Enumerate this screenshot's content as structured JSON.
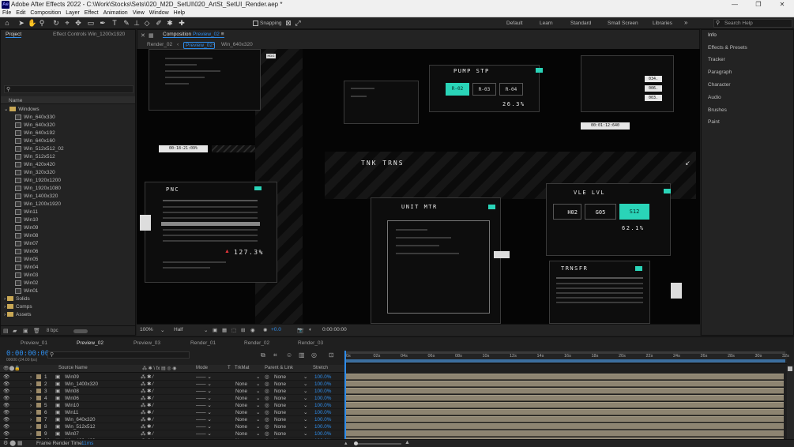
{
  "window": {
    "title": "Adobe After Effects 2022 - C:\\Work\\Stocks\\Sets\\020_M2D_SetUI\\020_ArtSt_SetUI_Render.aep *",
    "app_badge": "Ae"
  },
  "menu": [
    "File",
    "Edit",
    "Composition",
    "Layer",
    "Effect",
    "Animation",
    "View",
    "Window",
    "Help"
  ],
  "toolbar": {
    "snapping": "Snapping",
    "workspaces": [
      "Default",
      "Learn",
      "Standard",
      "Small Screen",
      "Libraries"
    ],
    "search_placeholder": "Search Help"
  },
  "project": {
    "tabs": [
      "Project",
      "Effect Controls Win_1200x1920"
    ],
    "column": "Name",
    "bpc": "8 bpc",
    "items": [
      {
        "name": "Windows",
        "type": "folder",
        "level": 0
      },
      {
        "name": "Win_640x330",
        "type": "comp",
        "level": 1
      },
      {
        "name": "Win_640x320",
        "type": "comp",
        "level": 1
      },
      {
        "name": "Win_640x192",
        "type": "comp",
        "level": 1
      },
      {
        "name": "Win_640x160",
        "type": "comp",
        "level": 1
      },
      {
        "name": "Win_512x512_02",
        "type": "comp",
        "level": 1
      },
      {
        "name": "Win_512x512",
        "type": "comp",
        "level": 1
      },
      {
        "name": "Win_420x420",
        "type": "comp",
        "level": 1
      },
      {
        "name": "Win_320x320",
        "type": "comp",
        "level": 1
      },
      {
        "name": "Win_1920x1200",
        "type": "comp",
        "level": 1
      },
      {
        "name": "Win_1920x1080",
        "type": "comp",
        "level": 1
      },
      {
        "name": "Win_1400x320",
        "type": "comp",
        "level": 1
      },
      {
        "name": "Win_1200x1920",
        "type": "comp",
        "level": 1
      },
      {
        "name": "Win11",
        "type": "comp",
        "level": 1
      },
      {
        "name": "Win10",
        "type": "comp",
        "level": 1
      },
      {
        "name": "Win09",
        "type": "comp",
        "level": 1
      },
      {
        "name": "Win08",
        "type": "comp",
        "level": 1
      },
      {
        "name": "Win07",
        "type": "comp",
        "level": 1
      },
      {
        "name": "Win06",
        "type": "comp",
        "level": 1
      },
      {
        "name": "Win05",
        "type": "comp",
        "level": 1
      },
      {
        "name": "Win04",
        "type": "comp",
        "level": 1
      },
      {
        "name": "Win03",
        "type": "comp",
        "level": 1
      },
      {
        "name": "Win02",
        "type": "comp",
        "level": 1
      },
      {
        "name": "Win01",
        "type": "comp",
        "level": 1
      },
      {
        "name": "Solids",
        "type": "folder",
        "level": 0
      },
      {
        "name": "Comps",
        "type": "folder",
        "level": 0
      },
      {
        "name": "Assets",
        "type": "folder",
        "level": 0
      }
    ]
  },
  "composition": {
    "panel_label": "Composition",
    "panel_name": "Preview_02",
    "breadcrumbs": [
      "Render_02",
      "Preview_02",
      "Win_640x320"
    ],
    "zoom": "100%",
    "resolution": "Half",
    "exposure": "+0.0",
    "timecode": "0:00:00:00",
    "hud": {
      "pump": "PUMP STP",
      "r02": "R-02",
      "r03": "R-03",
      "r04": "R-04",
      "pump_pct": "26.3%",
      "tnk": "TNK TRNS",
      "unit": "UNIT MTR",
      "vle": "VLE LVL",
      "h02": "H02",
      "g05": "G05",
      "s12": "S12",
      "vle_pct": "62.1%",
      "pnc": "PNC",
      "pnc_pct": "127.3%",
      "transfr": "TRNSFR",
      "time1": "00:18:21:09%",
      "time2": "00:01:12:640",
      "hdg": "HDG",
      "v1": "034.",
      "v2": "006.",
      "v3": "003."
    }
  },
  "right_panels": [
    "Info",
    "Effects & Presets",
    "Tracker",
    "Paragraph",
    "Character",
    "Audio",
    "Brushes",
    "Paint"
  ],
  "timeline": {
    "tabs": [
      "Preview_01",
      "Preview_02",
      "Preview_03",
      "Render_01",
      "Render_02",
      "Render_03"
    ],
    "active_tab": "Preview_02",
    "timecode": "0:00:00:00",
    "frame_info": "00000 (24.00 fps)",
    "columns": {
      "source": "Source Name",
      "mode": "Mode",
      "t": "T",
      "trkmat": "TrkMat",
      "parent": "Parent & Link",
      "stretch": "Stretch"
    },
    "ruler": [
      "0s",
      "02s",
      "04s",
      "06s",
      "08s",
      "10s",
      "12s",
      "14s",
      "16s",
      "18s",
      "20s",
      "22s",
      "24s",
      "26s",
      "28s",
      "30s",
      "32s"
    ],
    "layers": [
      {
        "n": "1",
        "name": "Win09",
        "trk": "",
        "parent": "None",
        "stretch": "100.0%"
      },
      {
        "n": "2",
        "name": "Win_1400x320",
        "trk": "None",
        "parent": "None",
        "stretch": "100.0%"
      },
      {
        "n": "3",
        "name": "Win08",
        "trk": "None",
        "parent": "None",
        "stretch": "100.0%"
      },
      {
        "n": "4",
        "name": "Win06",
        "trk": "None",
        "parent": "None",
        "stretch": "100.0%"
      },
      {
        "n": "5",
        "name": "Win10",
        "trk": "None",
        "parent": "None",
        "stretch": "100.0%"
      },
      {
        "n": "6",
        "name": "Win11",
        "trk": "None",
        "parent": "None",
        "stretch": "100.0%"
      },
      {
        "n": "7",
        "name": "Win_640x320",
        "trk": "None",
        "parent": "None",
        "stretch": "100.0%"
      },
      {
        "n": "8",
        "name": "Win_512x512",
        "trk": "None",
        "parent": "None",
        "stretch": "100.0%"
      },
      {
        "n": "9",
        "name": "Win07",
        "trk": "None",
        "parent": "None",
        "stretch": "100.0%"
      },
      {
        "n": "10",
        "name": "Win_420x420",
        "trk": "None",
        "parent": "None",
        "stretch": "100.0%"
      }
    ],
    "render_time_label": "Frame Render Time:",
    "render_time": "11ms"
  },
  "colors": {
    "accent": "#2d8ceb",
    "hud_cyan": "#2ad4b8",
    "folder": "#c9a855",
    "layer_bar": "#8d8471",
    "warning": "#e0343a"
  }
}
